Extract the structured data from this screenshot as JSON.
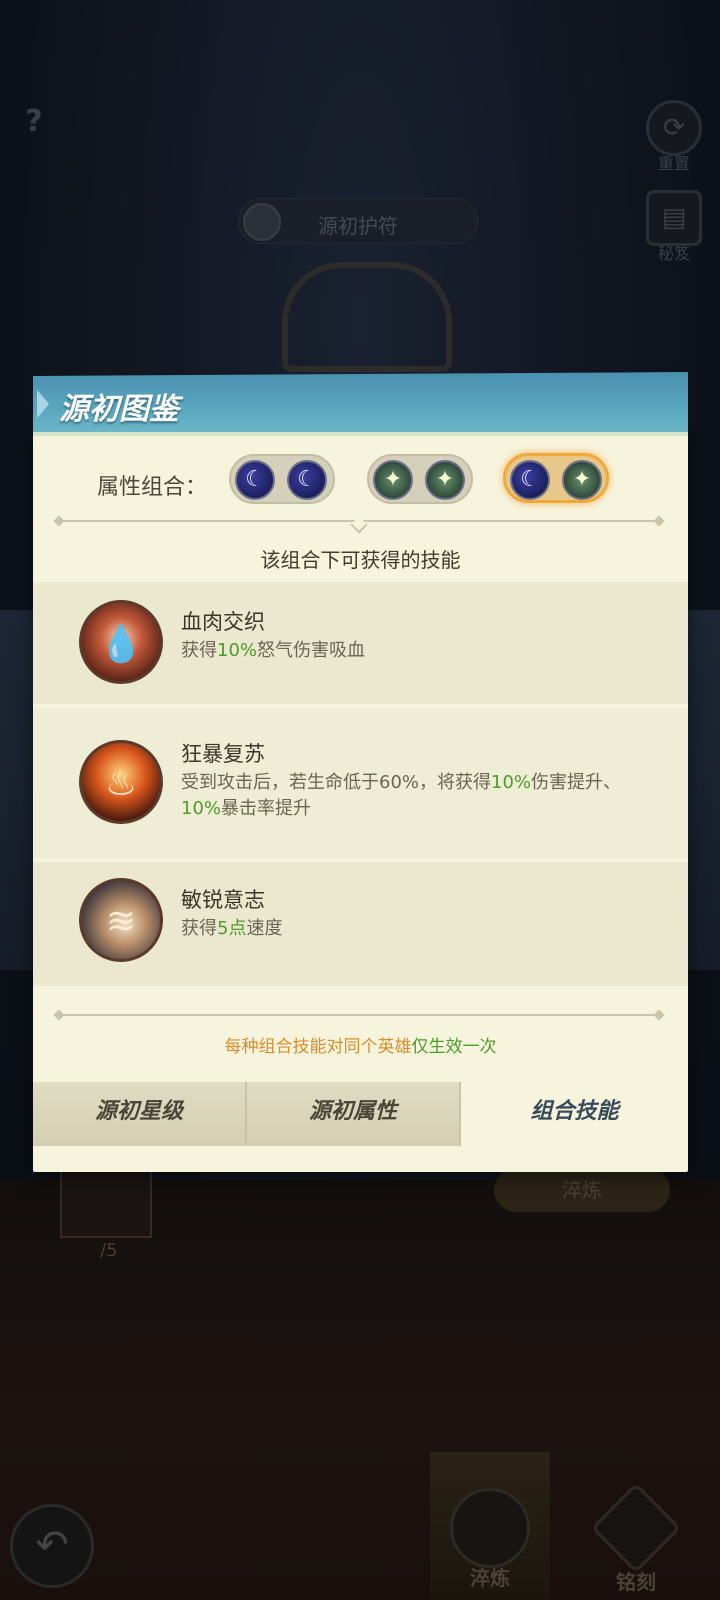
{
  "background": {
    "help_label": "?",
    "side_buttons": [
      {
        "label": "重置"
      },
      {
        "label": "秘笈"
      }
    ],
    "amulet_pill_label": "源初护符",
    "slot_count": "/5",
    "refine_tag": "淬炼",
    "bottom_tabs": [
      {
        "label": "淬炼"
      },
      {
        "label": "铭刻"
      }
    ]
  },
  "dialog": {
    "title": "源初图鉴",
    "combo_label": "属性组合：",
    "combos": [
      {
        "orbs": [
          "moon",
          "moon"
        ],
        "selected": false
      },
      {
        "orbs": [
          "star",
          "star"
        ],
        "selected": false
      },
      {
        "orbs": [
          "moon",
          "star"
        ],
        "selected": true
      }
    ],
    "subtitle": "该组合下可获得的技能",
    "skills": [
      {
        "name": "血肉交织",
        "icon": "blood-drop-icon",
        "desc_parts": [
          "获得",
          "10%",
          "怒气伤害吸血"
        ]
      },
      {
        "name": "狂暴复苏",
        "icon": "fury-figure-icon",
        "desc_parts": [
          "受到攻击后，若生命低于60%，将获得",
          "10%",
          "伤害提升、",
          "10%",
          "暴击率提升"
        ]
      },
      {
        "name": "敏锐意志",
        "icon": "swift-wind-icon",
        "desc_parts": [
          "获得",
          "5点",
          "速度"
        ]
      }
    ],
    "footnote": {
      "part1": "每种组合技能对同个英雄",
      "part2": "仅生效一次"
    },
    "tabs": [
      {
        "label": "源初星级",
        "active": false
      },
      {
        "label": "源初属性",
        "active": false
      },
      {
        "label": "组合技能",
        "active": true
      }
    ]
  },
  "colors": {
    "header_blue": "#5aa6bf",
    "panel_cream": "#f7f4de",
    "highlight_green": "#4d9b2a",
    "footnote_orange": "#d98b2b",
    "selected_combo_border": "#f0a83a"
  }
}
